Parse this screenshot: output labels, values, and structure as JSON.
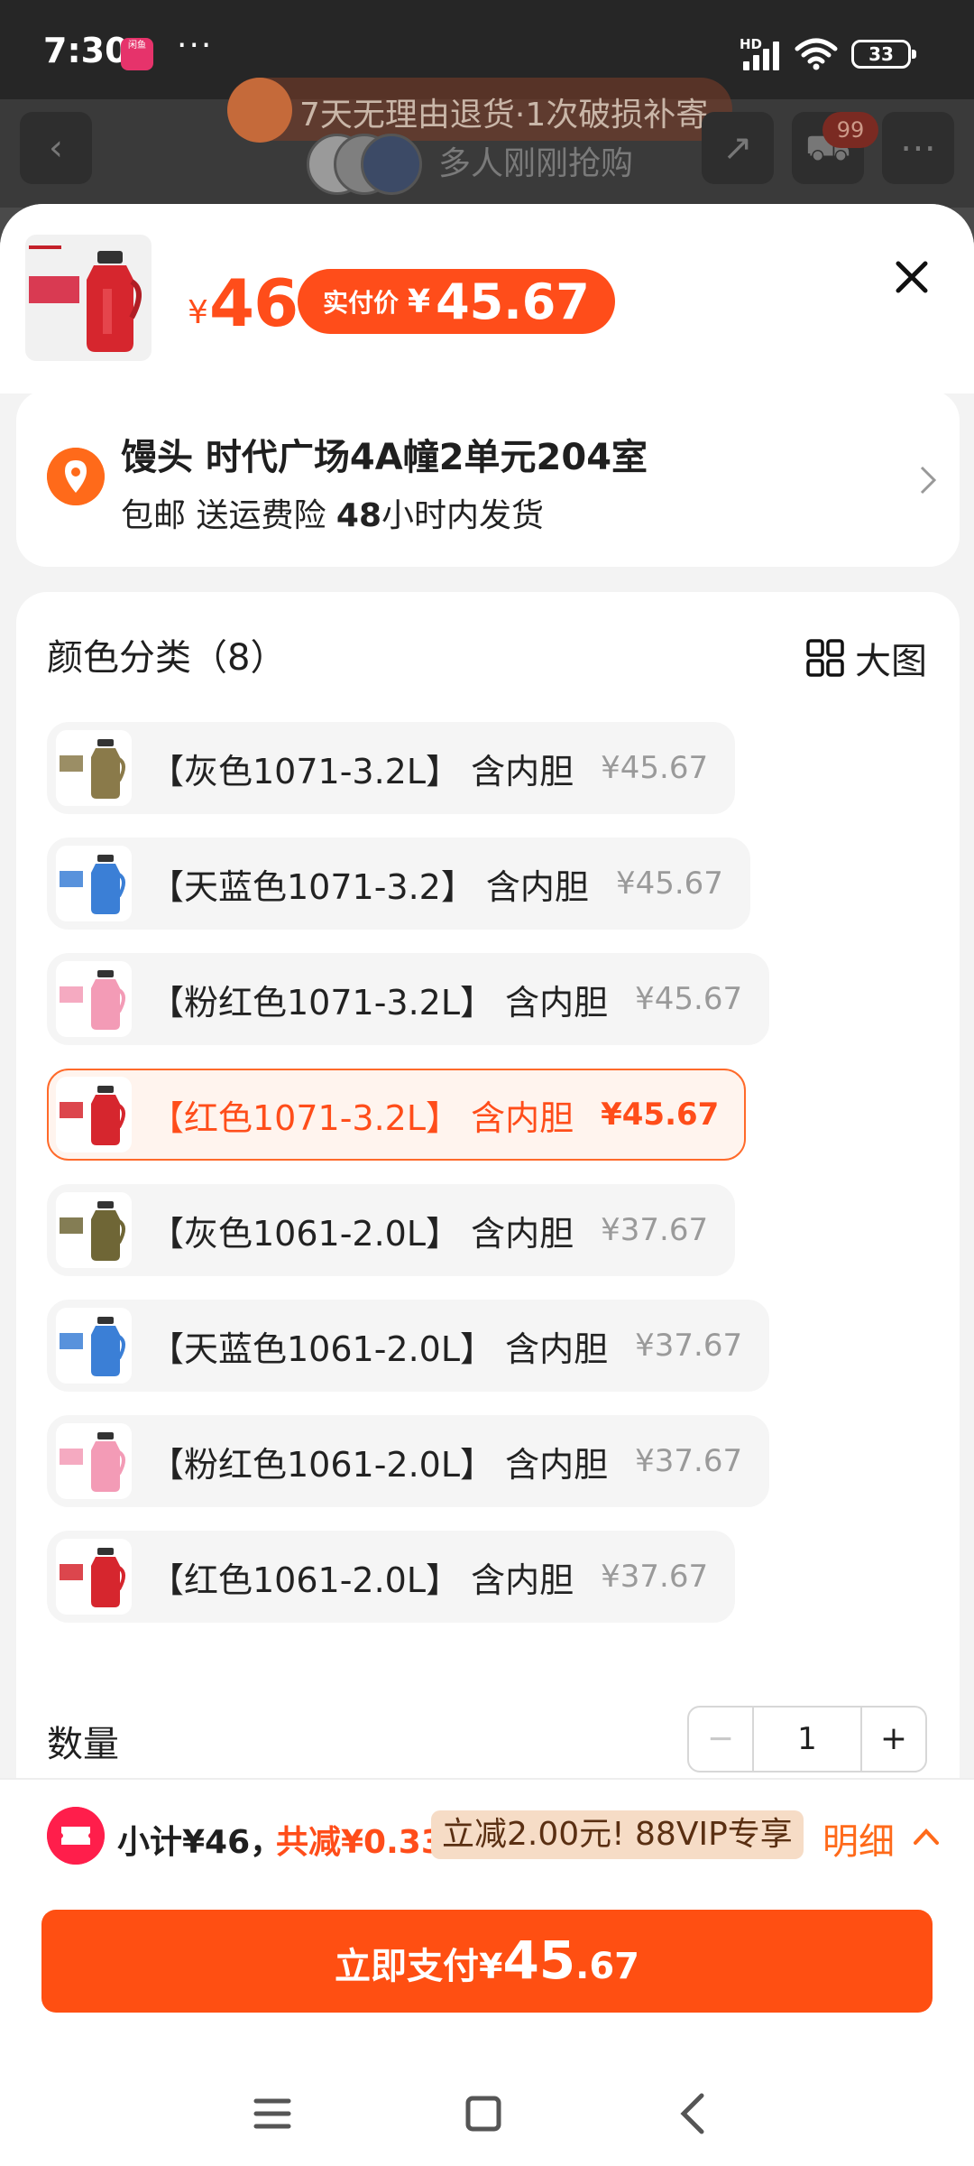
{
  "status_bar": {
    "time": "7:30",
    "app_badge": "闲鱼",
    "more": "···",
    "network": "HD",
    "battery": "33"
  },
  "background": {
    "banner_text": "7天无理由退货·1次破损补寄",
    "sub_text": "多人刚刚抢购",
    "cart_count": "99"
  },
  "product": {
    "price_currency": "¥",
    "price": "46",
    "actual_pay_label": "实付价",
    "actual_pay_currency": "¥",
    "actual_pay_value": "45.67"
  },
  "address": {
    "title": "馒头 时代广场4A幢2单元204室",
    "sub_prefix": "包邮 送运费险 ",
    "sub_bold": "48",
    "sub_suffix": "小时内发货"
  },
  "spec": {
    "title": "颜色分类（8）",
    "big_view": "大图",
    "options": [
      {
        "label": "【灰色1071-3.2L】 含内胆",
        "price": "¥45.67",
        "color": "#8a7a4a",
        "selected": false
      },
      {
        "label": "【天蓝色1071-3.2】 含内胆",
        "price": "¥45.67",
        "color": "#3b7fd6",
        "selected": false
      },
      {
        "label": "【粉红色1071-3.2L】 含内胆",
        "price": "¥45.67",
        "color": "#f39bb6",
        "selected": false
      },
      {
        "label": "【红色1071-3.2L】 含内胆",
        "price": "¥45.67",
        "color": "#d6262e",
        "selected": true
      },
      {
        "label": "【灰色1061-2.0L】 含内胆",
        "price": "¥37.67",
        "color": "#6f6636",
        "selected": false
      },
      {
        "label": "【天蓝色1061-2.0L】 含内胆",
        "price": "¥37.67",
        "color": "#3b7fd6",
        "selected": false
      },
      {
        "label": "【粉红色1061-2.0L】 含内胆",
        "price": "¥37.67",
        "color": "#f39bb6",
        "selected": false
      },
      {
        "label": "【红色1061-2.0L】 含内胆",
        "price": "¥37.67",
        "color": "#d6262e",
        "selected": false
      }
    ]
  },
  "quantity": {
    "label": "数量",
    "minus": "−",
    "value": "1",
    "plus": "+"
  },
  "footer": {
    "subtotal": "小计¥46，",
    "saved": "共减¥0.33",
    "vip_tag": "立减2.00元! 88VIP专享",
    "detail": "明细",
    "pay_text": "立即支付",
    "pay_currency": "¥",
    "pay_int": "45",
    "pay_dec": ".67"
  },
  "colors": {
    "accent": "#ff4d1a",
    "selected_bg": "#fff4ee"
  }
}
